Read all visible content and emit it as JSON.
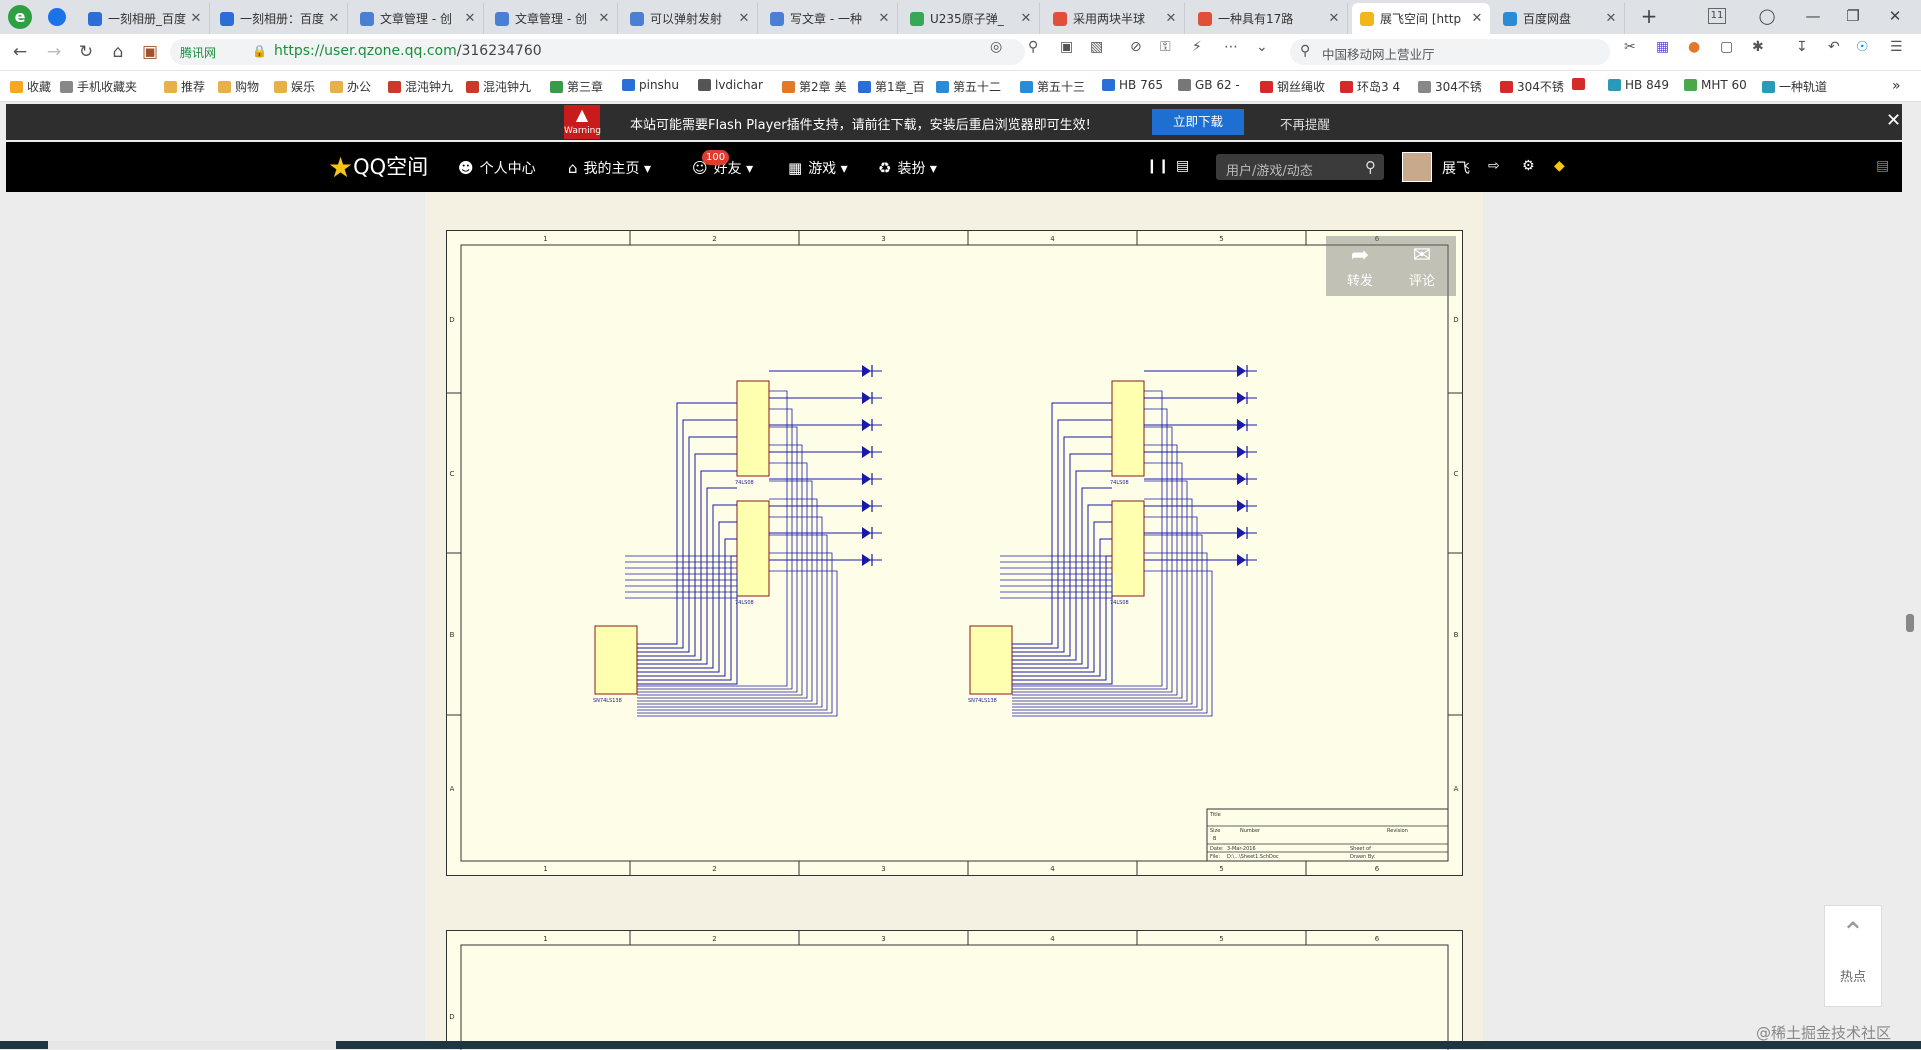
{
  "browser": {
    "tabs": [
      {
        "title": "一刻相册_百度",
        "color": "#2b6fd6"
      },
      {
        "title": "一刻相册：百度",
        "color": "#2b6fd6"
      },
      {
        "title": "文章管理 - 创",
        "color": "#4a7fd4"
      },
      {
        "title": "文章管理 - 创",
        "color": "#4a7fd4"
      },
      {
        "title": "可以弹射发射",
        "color": "#4a7fd4"
      },
      {
        "title": "写文章 - 一种",
        "color": "#4a7fd4"
      },
      {
        "title": "U235原子弹_",
        "color": "#37a855"
      },
      {
        "title": "采用两块半球",
        "color": "#e14f3a"
      },
      {
        "title": "一种具有17路",
        "color": "#e14f3a"
      },
      {
        "title": "展飞空间 [http",
        "color": "#f0b61a"
      },
      {
        "title": "百度网盘",
        "color": "#2b8bd6"
      }
    ],
    "tab_count": "11",
    "url_source": "腾讯网",
    "url_host": "https://user.qzone.qq.com",
    "url_path": "/316234760",
    "search_query": "中国移动网上营业厅",
    "bookmarks": [
      {
        "label": "收藏",
        "color": "#f5a623"
      },
      {
        "label": "手机收藏夹",
        "color": "#888888"
      },
      {
        "label": "推荐",
        "color": "#e8b04a"
      },
      {
        "label": "购物",
        "color": "#e8b04a"
      },
      {
        "label": "娱乐",
        "color": "#e8b04a"
      },
      {
        "label": "办公",
        "color": "#e8b04a"
      },
      {
        "label": "混沌钟九",
        "color": "#c83a2a"
      },
      {
        "label": "混沌钟九",
        "color": "#c83a2a"
      },
      {
        "label": "第三章",
        "color": "#3a9a4a"
      },
      {
        "label": "pinshu",
        "color": "#2a6fd6"
      },
      {
        "label": "lvdichar",
        "color": "#555555"
      },
      {
        "label": "第2章 美",
        "color": "#e07a2a"
      },
      {
        "label": "第1章_百",
        "color": "#2b6fd6"
      },
      {
        "label": "第五十二",
        "color": "#2b8bd6"
      },
      {
        "label": "第五十三",
        "color": "#2b8bd6"
      },
      {
        "label": "HB 765",
        "color": "#2a6fd6"
      },
      {
        "label": "GB 62 -",
        "color": "#777777"
      },
      {
        "label": "钢丝绳收",
        "color": "#d42a2a"
      },
      {
        "label": "环岛3 4",
        "color": "#d42a2a"
      },
      {
        "label": "304不锈",
        "color": "#888888"
      },
      {
        "label": "304不锈",
        "color": "#d42a2a"
      },
      {
        "label": "",
        "color": "#d42a2a"
      },
      {
        "label": "HB 849",
        "color": "#2a9ab8"
      },
      {
        "label": "MHT 60",
        "color": "#4aa84a"
      },
      {
        "label": "一种轨道",
        "color": "#2a9ab8"
      }
    ]
  },
  "flash_bar": {
    "warning_label": "Warning",
    "message": "本站可能需要Flash Player插件支持，请前往下载，安装后重启浏览器即可生效!",
    "download_button": "立即下载",
    "dismiss_button": "不再提醒"
  },
  "qzone_nav": {
    "logo": "QQ空间",
    "items": [
      "个人中心",
      "我的主页",
      "好友",
      "游戏",
      "装扮"
    ],
    "friend_badge": "100",
    "search_placeholder": "用户/游戏/动态",
    "username": "展飞"
  },
  "photo_actions": {
    "share": "转发",
    "comment": "评论"
  },
  "schematic": {
    "col_labels": [
      "1",
      "2",
      "3",
      "4",
      "5",
      "6"
    ],
    "row_labels": [
      "D",
      "C",
      "B",
      "A"
    ],
    "ic_labels": [
      "74LS08",
      "74LS08",
      "SN74LS138"
    ],
    "title_block": {
      "title": "Title",
      "size": "Size",
      "size_value": "B",
      "number": "Number",
      "revision": "Revision",
      "date": "Date:",
      "date_value": "3-Mar-2016",
      "sheet": "Sheet  of",
      "file": "File:",
      "file_value": "D:\\...\\Sheet1.SchDoc",
      "drawn": "Drawn By:"
    }
  },
  "right_float": {
    "hot_label": "热点"
  },
  "watermark": "@稀土掘金技术社区"
}
